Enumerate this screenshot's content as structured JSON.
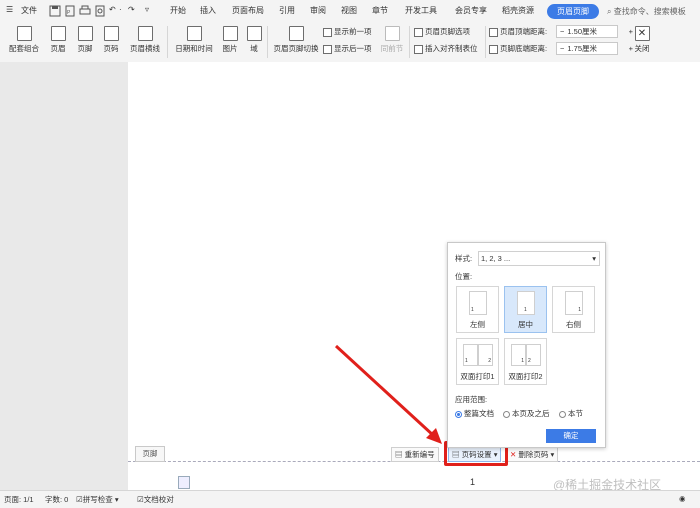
{
  "menubar": {
    "menu_label": "文件",
    "tabs": [
      "开始",
      "插入",
      "页面布局",
      "引用",
      "审阅",
      "视图",
      "章节",
      "开发工具",
      "会员专享",
      "稻壳资源"
    ],
    "active_tab": "页眉页脚",
    "search_placeholder": "查找命令、搜索模板"
  },
  "ribbon": {
    "buttons": [
      "配套组合",
      "页眉",
      "页脚",
      "页码",
      "页眉横线",
      "日期和时间",
      "图片",
      "域",
      "页眉页脚切换"
    ],
    "show_prev": "显示前一项",
    "show_next": "显示后一项",
    "same_prev": "同前节",
    "hf_options": "页眉页脚选项",
    "align_tab": "插入对齐制表位",
    "header_top_label": "页眉顶端距离:",
    "header_top_value": "1.50厘米",
    "footer_bottom_label": "页脚底端距离:",
    "footer_bottom_value": "1.75厘米",
    "close_label": "关闭"
  },
  "footer_bar": {
    "tag": "页脚",
    "renumber": "重新编号",
    "page_setup": "页码设置",
    "delete_page_number": "删除页码",
    "page_number": "1"
  },
  "popup": {
    "style_label": "样式:",
    "style_value": "1, 2, 3 ...",
    "position_label": "位置:",
    "positions": [
      "左侧",
      "居中",
      "右侧",
      "双面打印1",
      "双面打印2"
    ],
    "selected_position": "居中",
    "scope_label": "应用范围:",
    "scope_options": [
      "整篇文档",
      "本页及之后",
      "本节"
    ],
    "selected_scope": "整篇文档",
    "ok_label": "确定"
  },
  "statusbar": {
    "page": "页面: 1/1",
    "words": "字数: 0",
    "spellcheck": "拼写检查",
    "proofread": "文档校对"
  },
  "watermark": "@稀土掘金技术社区",
  "colors": {
    "accent": "#3c7be6",
    "highlight": "#e0201b"
  }
}
